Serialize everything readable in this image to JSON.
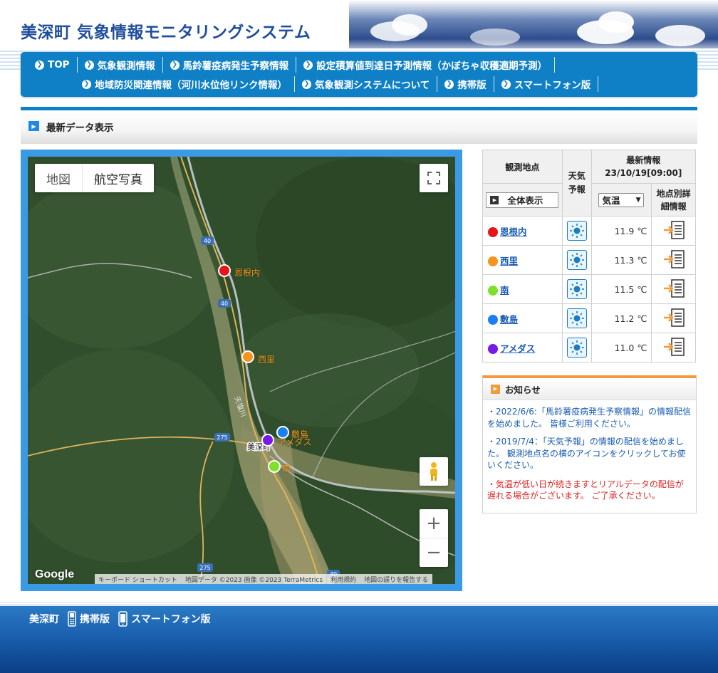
{
  "header": {
    "title": "美深町 気象情報モニタリングシステム"
  },
  "nav": {
    "row1": [
      {
        "label": "TOP"
      },
      {
        "label": "気象観測情報"
      },
      {
        "label": "馬鈴薯疫病発生予察情報"
      },
      {
        "label": "設定積算値到達日予測情報（かぼちゃ収穫適期予測）"
      }
    ],
    "row2": [
      {
        "label": "地域防災関連情報（河川水位他リンク情報）"
      },
      {
        "label": "気象観測システムについて"
      },
      {
        "label": "携帯版"
      },
      {
        "label": "スマートフォン版"
      }
    ]
  },
  "section": {
    "title": "最新データ表示"
  },
  "map": {
    "type_map": "地図",
    "type_satellite": "航空写真",
    "google": "Google",
    "attrib": [
      "キーボード ショートカット",
      "地図データ ©2023 画像 ©2023 TerraMetrics",
      "利用規約",
      "地図の誤りを報告する"
    ],
    "road_labels": [
      "40",
      "40",
      "275",
      "275",
      "40"
    ],
    "river_label": "天塩川",
    "town_label": "美深町",
    "markers": [
      {
        "name": "恩根内",
        "color": "#e8141a"
      },
      {
        "name": "西里",
        "color": "#f7931e"
      },
      {
        "name": "南",
        "color": "#7fe02a"
      },
      {
        "name": "敷島",
        "color": "#1a7ff0"
      },
      {
        "name": "アメダス",
        "color": "#7a18e8"
      }
    ]
  },
  "table": {
    "col_location": "観測地点",
    "col_forecast": "天気予報",
    "col_latest_title": "最新情報",
    "col_latest_time": "23/10/19[09:00]",
    "col_detail": "地点別詳細情報",
    "show_all": "全体表示",
    "select_value": "気温",
    "rows": [
      {
        "name": "恩根内",
        "color": "#e8141a",
        "temp": "11.9 ℃"
      },
      {
        "name": "西里",
        "color": "#f7931e",
        "temp": "11.3 ℃"
      },
      {
        "name": "南",
        "color": "#7fe02a",
        "temp": "11.5 ℃"
      },
      {
        "name": "敷島",
        "color": "#1a7ff0",
        "temp": "11.2 ℃"
      },
      {
        "name": "アメダス",
        "color": "#7a18e8",
        "temp": "11.0 ℃"
      }
    ]
  },
  "notice": {
    "title": "お知らせ",
    "items": [
      {
        "text": "・2022/6/6:「馬鈴薯疫病発生予察情報」の情報配信を始めました。 皆様ご利用ください。"
      },
      {
        "text": "・2019/7/4：「天気予報」の情報の配信を始めました。 観測地点名の横のアイコンをクリックしてお使いください。"
      },
      {
        "text": "・気温が低い日が続きますとリアルデータの配信が遅れる場合がございます。 ご了承ください。"
      }
    ]
  },
  "footer": {
    "town": "美深町",
    "mobile": "携帯版",
    "smartphone": "スマートフォン版"
  }
}
